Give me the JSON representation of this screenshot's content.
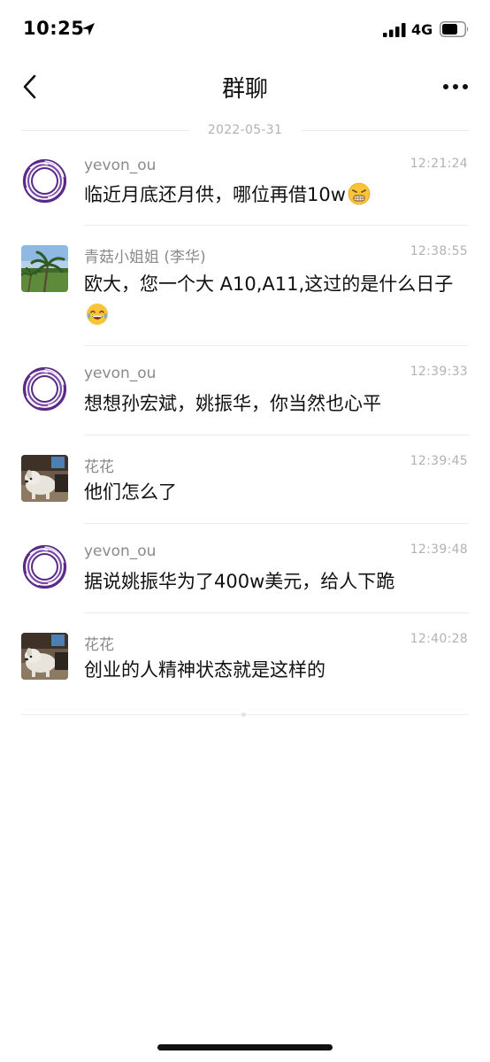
{
  "status_bar": {
    "time": "10:25",
    "network": "4G"
  },
  "nav": {
    "title": "群聊"
  },
  "date_divider": "2022-05-31",
  "messages": [
    {
      "sender": "yevon_ou",
      "time": "12:21:24",
      "text": "临近月底还月供，哪位再借10w",
      "emoji": "grimacing-face-emoji",
      "avatar": "purple-ring-avatar"
    },
    {
      "sender": "青菇小姐姐 (李华)",
      "time": "12:38:55",
      "text": "欧大，您一个大 A10,A11,这过的是什么日子",
      "emoji": "tears-of-joy-emoji",
      "avatar": "palm-tree-photo-avatar"
    },
    {
      "sender": "yevon_ou",
      "time": "12:39:33",
      "text": "想想孙宏斌，姚振华，你当然也心平",
      "avatar": "purple-ring-avatar"
    },
    {
      "sender": "花花",
      "time": "12:39:45",
      "text": "他们怎么了",
      "avatar": "dog-photo-avatar"
    },
    {
      "sender": "yevon_ou",
      "time": "12:39:48",
      "text": "据说姚振华为了400w美元，给人下跪",
      "avatar": "purple-ring-avatar"
    },
    {
      "sender": "花花",
      "time": "12:40:28",
      "text": "创业的人精神状态就是这样的",
      "avatar": "dog-photo-avatar"
    }
  ],
  "colors": {
    "ring_purple": "#5b2a86",
    "secondary_text": "#8a8a8a",
    "timestamp_text": "#b2b2b2",
    "divider": "#ececec"
  }
}
